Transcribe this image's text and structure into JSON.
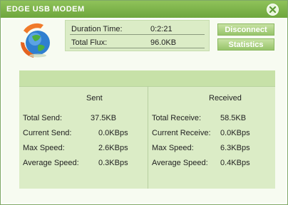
{
  "window": {
    "title": "EDGE USB MODEM"
  },
  "info": {
    "duration_label": "Duration Time:",
    "duration_value": "0:2:21",
    "flux_label": "Total Flux:",
    "flux_value": "96.0KB"
  },
  "buttons": {
    "disconnect": "Disconnect",
    "statistics": "Statistics"
  },
  "stats": {
    "sent_header": "Sent",
    "received_header": "Received",
    "sent_rows": [
      {
        "label": "Total Send:",
        "value": "37.5KB"
      },
      {
        "label": "Current Send:",
        "value": "0.0KBps"
      },
      {
        "label": "Max Speed:",
        "value": "2.6KBps"
      },
      {
        "label": "Average Speed:",
        "value": "0.3KBps"
      }
    ],
    "received_rows": [
      {
        "label": "Total Receive:",
        "value": "58.5KB"
      },
      {
        "label": "Current Receive:",
        "value": "0.0KBps"
      },
      {
        "label": "Max Speed:",
        "value": "6.3KBps"
      },
      {
        "label": "Average Speed:",
        "value": "0.4KBps"
      }
    ]
  },
  "colors": {
    "accent": "#7ab048",
    "panel": "#dbecc6",
    "titlebar": "#6ea63d"
  },
  "icons": {
    "close": "close-icon",
    "logo": "globe-logo-icon"
  }
}
